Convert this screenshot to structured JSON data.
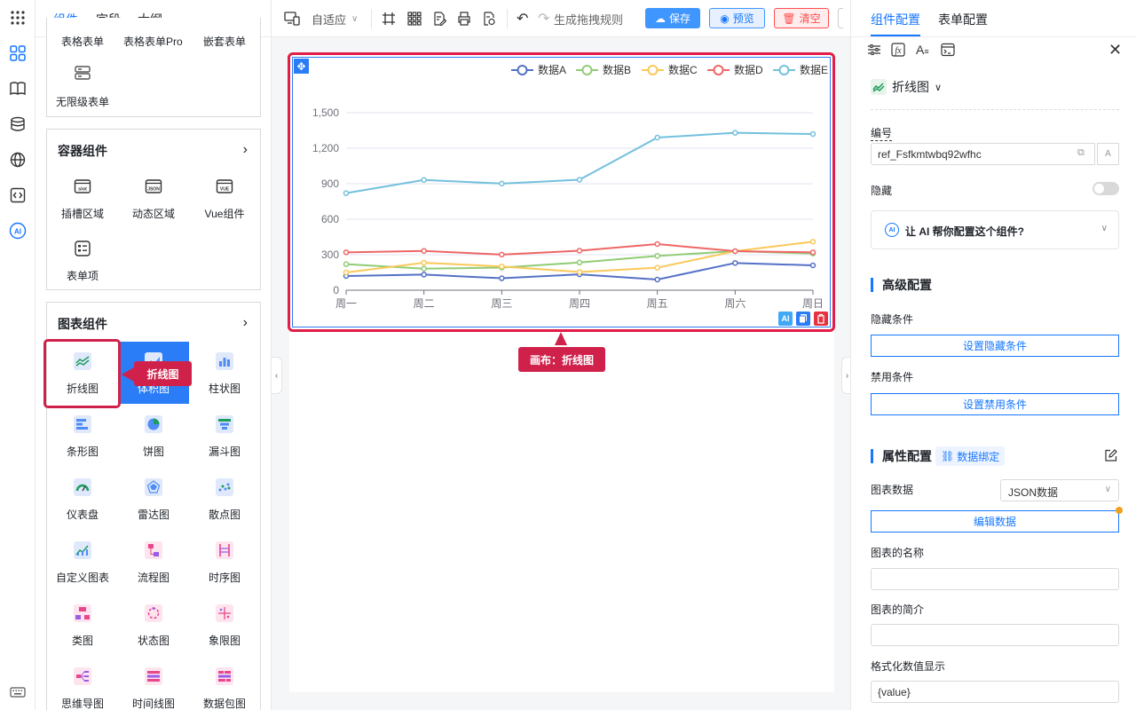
{
  "left_tabs": [
    "组件",
    "字段",
    "大纲"
  ],
  "top_partial": {
    "items": [
      "表格表单",
      "表格表单Pro",
      "嵌套表单"
    ],
    "unlimited": "无限级表单"
  },
  "container_group": {
    "title": "容器组件",
    "items": [
      {
        "label": "插槽区域",
        "icon": "slot-icon"
      },
      {
        "label": "动态区域",
        "icon": "json-icon"
      },
      {
        "label": "Vue组件",
        "icon": "vue-icon"
      },
      {
        "label": "表单项",
        "icon": "form-item-icon"
      }
    ]
  },
  "chart_group": {
    "title": "图表组件",
    "items": [
      {
        "label": "折线图",
        "icon": "line-chart-icon"
      },
      {
        "label": "体积图",
        "icon": "volume-chart-icon"
      },
      {
        "label": "柱状图",
        "icon": "bar-chart-icon"
      },
      {
        "label": "条形图",
        "icon": "hbar-chart-icon"
      },
      {
        "label": "饼图",
        "icon": "pie-chart-icon"
      },
      {
        "label": "漏斗图",
        "icon": "funnel-chart-icon"
      },
      {
        "label": "仪表盘",
        "icon": "gauge-icon"
      },
      {
        "label": "雷达图",
        "icon": "radar-chart-icon"
      },
      {
        "label": "散点图",
        "icon": "scatter-chart-icon"
      },
      {
        "label": "自定义图表",
        "icon": "custom-chart-icon"
      },
      {
        "label": "流程图",
        "icon": "flow-chart-icon"
      },
      {
        "label": "时序图",
        "icon": "sequence-chart-icon"
      },
      {
        "label": "类图",
        "icon": "class-chart-icon"
      },
      {
        "label": "状态图",
        "icon": "state-chart-icon"
      },
      {
        "label": "象限图",
        "icon": "quadrant-chart-icon"
      },
      {
        "label": "思维导图",
        "icon": "mindmap-icon"
      },
      {
        "label": "时间线图",
        "icon": "timeline-icon"
      },
      {
        "label": "数据包图",
        "icon": "packet-icon"
      }
    ]
  },
  "callout_left": "折线图",
  "callout_canvas": "画布：折线图",
  "toolbar": {
    "adapt": "自适应",
    "rule": "生成拖拽规则",
    "save": "保存",
    "preview": "预览",
    "clear": "清空"
  },
  "right_tabs": [
    "组件配置",
    "表单配置"
  ],
  "right": {
    "component_type": "折线图",
    "id_label": "编号",
    "id_value": "ref_Fsfkmtwbq92wfhc",
    "hidden_label": "隐藏",
    "ai_prompt": "让 AI 帮你配置这个组件?",
    "advanced_title": "高级配置",
    "hide_cond_label": "隐藏条件",
    "hide_cond_btn": "设置隐藏条件",
    "disable_cond_label": "禁用条件",
    "disable_cond_btn": "设置禁用条件",
    "prop_title": "属性配置",
    "data_bind": "数据绑定",
    "chart_data_label": "图表数据",
    "chart_data_select": "JSON数据",
    "edit_data_btn": "编辑数据",
    "chart_name_label": "图表的名称",
    "chart_intro_label": "图表的简介",
    "format_label": "格式化数值显示",
    "format_value": "{value}"
  },
  "chart_data": {
    "type": "line",
    "categories": [
      "周一",
      "周二",
      "周三",
      "周四",
      "周五",
      "周六",
      "周日"
    ],
    "ylim": [
      0,
      1500
    ],
    "yticks": [
      "0",
      "300",
      "600",
      "900",
      "1,200",
      "1,500"
    ],
    "series": [
      {
        "name": "数据A",
        "color": "#5470c6",
        "values": [
          120,
          132,
          101,
          134,
          90,
          230,
          210
        ]
      },
      {
        "name": "数据B",
        "color": "#91cc75",
        "values": [
          220,
          182,
          191,
          234,
          290,
          330,
          310
        ]
      },
      {
        "name": "数据C",
        "color": "#fac858",
        "values": [
          150,
          232,
          201,
          154,
          190,
          330,
          410
        ]
      },
      {
        "name": "数据D",
        "color": "#ee6666",
        "values": [
          320,
          332,
          301,
          334,
          390,
          330,
          320
        ]
      },
      {
        "name": "数据E",
        "color": "#73c0de",
        "values": [
          820,
          932,
          901,
          934,
          1290,
          1330,
          1320
        ]
      }
    ]
  }
}
